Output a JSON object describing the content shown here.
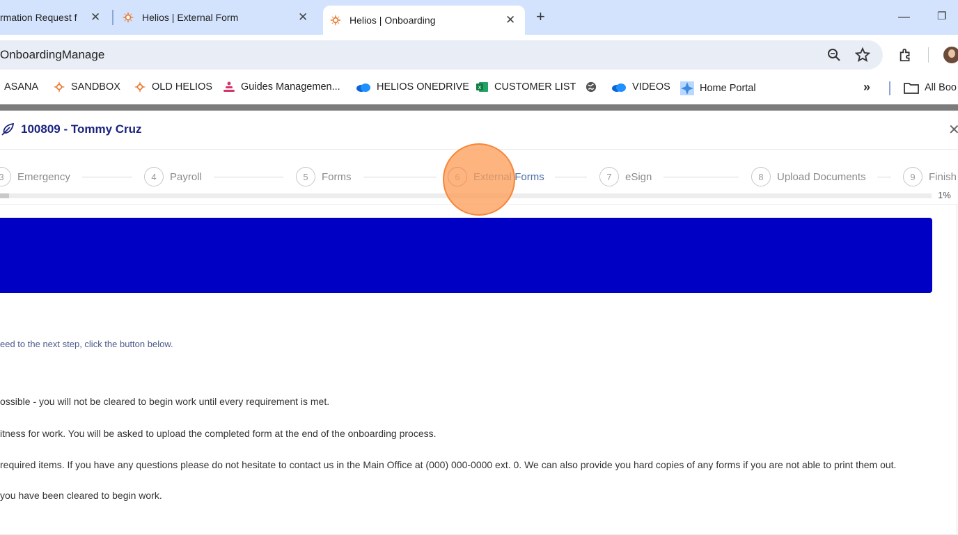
{
  "tabs": [
    {
      "title": "rmation Request f",
      "active": false
    },
    {
      "title": "Helios | External Form",
      "active": false
    },
    {
      "title": "Helios | Onboarding",
      "active": true
    }
  ],
  "address_bar": {
    "url": "OnboardingManage"
  },
  "bookmarks": [
    {
      "label": "ASANA",
      "icon": "none"
    },
    {
      "label": "SANDBOX",
      "icon": "helios-sun-icon"
    },
    {
      "label": "OLD HELIOS",
      "icon": "helios-sun-icon"
    },
    {
      "label": "Guides Managemen...",
      "icon": "guides-icon"
    },
    {
      "label": "HELIOS ONEDRIVE",
      "icon": "onedrive-cloud-icon"
    },
    {
      "label": "CUSTOMER LIST",
      "icon": "excel-icon"
    },
    {
      "label": "",
      "icon": "globe-icon"
    },
    {
      "label": "VIDEOS",
      "icon": "onedrive-cloud-icon"
    },
    {
      "label": "Home Portal",
      "icon": "portal-star-icon"
    },
    {
      "label": "All Boo",
      "icon": "folder-icon"
    }
  ],
  "record": {
    "title": "100809 - Tommy Cruz"
  },
  "steps": [
    {
      "num": "3",
      "label": "Emergency"
    },
    {
      "num": "4",
      "label": "Payroll"
    },
    {
      "num": "5",
      "label": "Forms"
    },
    {
      "num": "6",
      "label": "External Forms"
    },
    {
      "num": "7",
      "label": "eSign"
    },
    {
      "num": "8",
      "label": "Upload Documents"
    },
    {
      "num": "9",
      "label": "Finish"
    }
  ],
  "progress": {
    "label": "1%",
    "value": 0.01
  },
  "content": {
    "proceed_text": "eed to the next step, click the button below.",
    "paragraphs": [
      "ossible - you will not be cleared to begin work until every requirement is met.",
      "itness for work. You will be asked to upload the completed form at the end of the onboarding process.",
      " required items. If you have any questions please do not hesitate to contact us in the Main Office at (000) 000-0000 ext. 0. We can also provide you hard copies of any forms if you are not able to print them out.",
      " you have been cleared to begin work."
    ]
  },
  "colors": {
    "banner": "#0000c4",
    "title": "#1a237e",
    "highlight": "#fc9f5a",
    "tabstrip": "#d3e3fd"
  }
}
